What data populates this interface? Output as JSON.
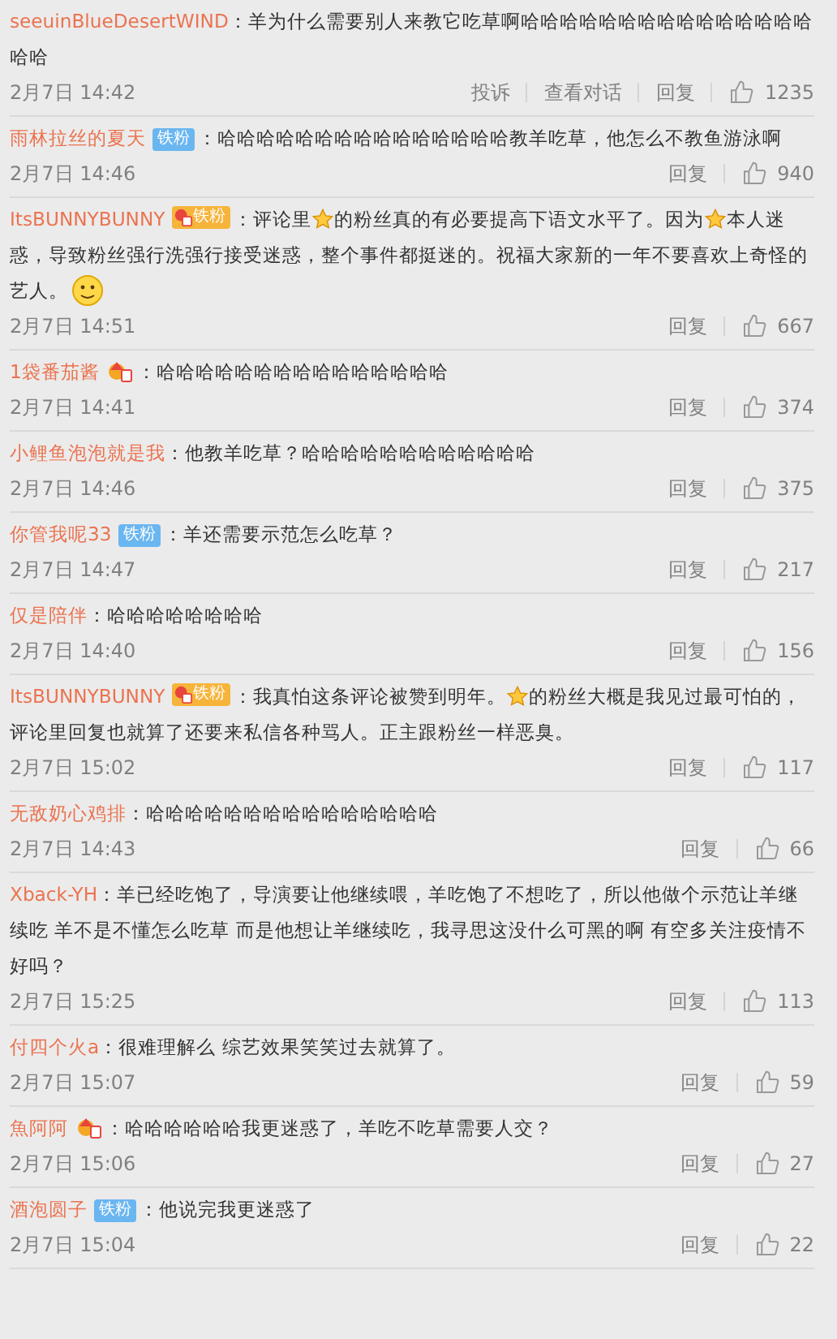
{
  "comments": [
    {
      "name": "seeuinBlueDesertWIND",
      "lines": [
        [
          {
            "kind": "text",
            "text": "：羊为什么需要别人来教它吃草啊哈哈哈哈哈哈哈哈哈哈哈哈哈哈哈"
          }
        ],
        [
          {
            "kind": "text",
            "text": "哈哈"
          }
        ]
      ],
      "time": "2月7日 14:42",
      "actions": [
        "投诉",
        "查看对话",
        "回复"
      ],
      "likes": "1235"
    },
    {
      "name": "雨林拉丝的夏天",
      "badge": {
        "kind": "blue",
        "label": "铁粉"
      },
      "lines": [
        [
          {
            "kind": "text",
            "text": "：哈哈哈哈哈哈哈哈哈哈哈哈哈哈哈教羊吃草，他怎么不教鱼游泳啊"
          }
        ]
      ],
      "time": "2月7日 14:46",
      "actions": [
        "回复"
      ],
      "likes": "940"
    },
    {
      "name": "ItsBUNNYBUNNY",
      "badge": {
        "kind": "gold",
        "label": "铁粉"
      },
      "lines": [
        [
          {
            "kind": "text",
            "text": "：评论里"
          },
          {
            "kind": "star"
          },
          {
            "kind": "text",
            "text": "的粉丝真的有必要提高下语文水平了。因为"
          },
          {
            "kind": "star"
          },
          {
            "kind": "text",
            "text": "本人迷"
          }
        ],
        [
          {
            "kind": "text",
            "text": "惑，导致粉丝强行洗强行接受迷惑，整个事件都挺迷的。祝福大家新的一年不要喜欢上奇怪的"
          }
        ],
        [
          {
            "kind": "text",
            "text": "艺人。"
          },
          {
            "kind": "emoji"
          }
        ]
      ],
      "time": "2月7日 14:51",
      "actions": [
        "回复"
      ],
      "likes": "667"
    },
    {
      "name": "1袋番茄酱",
      "badge": {
        "kind": "icon"
      },
      "lines": [
        [
          {
            "kind": "text",
            "text": "：哈哈哈哈哈哈哈哈哈哈哈哈哈哈哈"
          }
        ]
      ],
      "time": "2月7日 14:41",
      "actions": [
        "回复"
      ],
      "likes": "374"
    },
    {
      "name": "小鲤鱼泡泡就是我",
      "lines": [
        [
          {
            "kind": "text",
            "text": "：他教羊吃草？哈哈哈哈哈哈哈哈哈哈哈哈"
          }
        ]
      ],
      "time": "2月7日 14:46",
      "actions": [
        "回复"
      ],
      "likes": "375"
    },
    {
      "name": "你管我呢33",
      "badge": {
        "kind": "blue",
        "label": "铁粉"
      },
      "lines": [
        [
          {
            "kind": "text",
            "text": "：羊还需要示范怎么吃草？"
          }
        ]
      ],
      "time": "2月7日 14:47",
      "actions": [
        "回复"
      ],
      "likes": "217"
    },
    {
      "name": "仅是陪伴",
      "lines": [
        [
          {
            "kind": "text",
            "text": "：哈哈哈哈哈哈哈哈"
          }
        ]
      ],
      "time": "2月7日 14:40",
      "actions": [
        "回复"
      ],
      "likes": "156"
    },
    {
      "name": "ItsBUNNYBUNNY",
      "badge": {
        "kind": "gold",
        "label": "铁粉"
      },
      "lines": [
        [
          {
            "kind": "text",
            "text": "：我真怕这条评论被赞到明年。"
          },
          {
            "kind": "star"
          },
          {
            "kind": "text",
            "text": "的粉丝大概是我见过最可怕的，"
          }
        ],
        [
          {
            "kind": "text",
            "text": "评论里回复也就算了还要来私信各种骂人。正主跟粉丝一样恶臭。"
          }
        ]
      ],
      "time": "2月7日 15:02",
      "actions": [
        "回复"
      ],
      "likes": "117"
    },
    {
      "name": "无敌奶心鸡排",
      "lines": [
        [
          {
            "kind": "text",
            "text": "：哈哈哈哈哈哈哈哈哈哈哈哈哈哈哈"
          }
        ]
      ],
      "time": "2月7日 14:43",
      "actions": [
        "回复"
      ],
      "likes": "66"
    },
    {
      "name": "Xback-YH",
      "lines": [
        [
          {
            "kind": "text",
            "text": "：羊已经吃饱了，导演要让他继续喂，羊吃饱了不想吃了，所以他做个示范让羊继"
          }
        ],
        [
          {
            "kind": "text",
            "text": "续吃 羊不是不懂怎么吃草 而是他想让羊继续吃，我寻思这没什么可黑的啊 有空多关注疫情不"
          }
        ],
        [
          {
            "kind": "text",
            "text": "好吗？"
          }
        ]
      ],
      "time": "2月7日 15:25",
      "actions": [
        "回复"
      ],
      "likes": "113"
    },
    {
      "name": "付四个火a",
      "lines": [
        [
          {
            "kind": "text",
            "text": "：很难理解么 综艺效果笑笑过去就算了。"
          }
        ]
      ],
      "time": "2月7日 15:07",
      "actions": [
        "回复"
      ],
      "likes": "59"
    },
    {
      "name": "魚阿阿",
      "badge": {
        "kind": "icon"
      },
      "lines": [
        [
          {
            "kind": "text",
            "text": "：哈哈哈哈哈哈我更迷惑了，羊吃不吃草需要人交？"
          }
        ]
      ],
      "time": "2月7日 15:06",
      "actions": [
        "回复"
      ],
      "likes": "27"
    },
    {
      "name": "酒泡圆子",
      "badge": {
        "kind": "blue",
        "label": "铁粉"
      },
      "lines": [
        [
          {
            "kind": "text",
            "text": "：他说完我更迷惑了"
          }
        ]
      ],
      "time": "2月7日 15:04",
      "actions": [
        "回复"
      ],
      "likes": "22"
    }
  ]
}
